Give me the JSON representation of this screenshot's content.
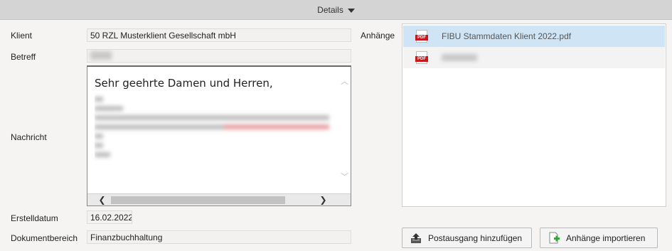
{
  "header": {
    "title": "Details"
  },
  "labels": {
    "klient": "Klient",
    "betreff": "Betreff",
    "nachricht": "Nachricht",
    "erstelldatum": "Erstelldatum",
    "dokumentbereich": "Dokumentbereich",
    "anhaenge": "Anhänge"
  },
  "fields": {
    "klient": "50 RZL Musterklient Gesellschaft mbH",
    "erstelldatum": "16.02.2022",
    "dokumentbereich": "Finanzbuchhaltung"
  },
  "message": {
    "greeting": "Sehr geehrte Damen und Herren,"
  },
  "attachments": [
    {
      "name": "FIBU Stammdaten Klient 2022.pdf",
      "selected": true
    },
    {
      "name": "",
      "selected": false
    }
  ],
  "buttons": {
    "postausgang": "Postausgang hinzufügen",
    "importieren": "Anhänge importieren"
  },
  "icons": {
    "expand": "chevron-down-icon",
    "pdf": "pdf-file-icon",
    "postausgang": "outbox-upload-icon",
    "importieren": "add-document-icon"
  }
}
